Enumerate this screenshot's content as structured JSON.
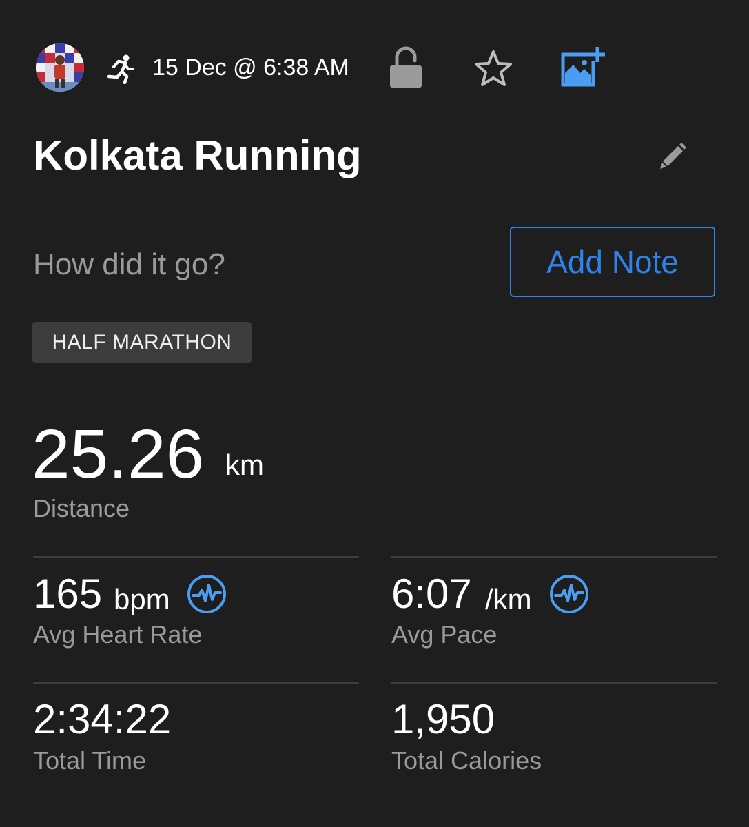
{
  "header": {
    "activity_icon": "running-person-icon",
    "date_time": "15 Dec @ 6:38 AM",
    "privacy_icon": "unlocked-padlock-icon",
    "favorite_icon": "star-outline-icon",
    "add_photo_icon": "add-photo-icon"
  },
  "activity": {
    "title": "Kolkata Running",
    "edit_icon": "pencil-icon",
    "note_prompt": "How did it go?",
    "add_note_label": "Add Note",
    "badge": "HALF MARATHON"
  },
  "distance": {
    "value": "25.26",
    "unit": "km",
    "label": "Distance"
  },
  "stats": {
    "heart_rate": {
      "value": "165",
      "unit": "bpm",
      "label": "Avg Heart Rate",
      "icon": "pulse-chart-icon"
    },
    "pace": {
      "value": "6:07",
      "unit": "/km",
      "label": "Avg Pace",
      "icon": "pulse-chart-icon"
    },
    "time": {
      "value": "2:34:22",
      "label": "Total Time"
    },
    "calories": {
      "value": "1,950",
      "label": "Total Calories"
    }
  },
  "colors": {
    "background": "#1e1e1e",
    "accent": "#2f82e8",
    "icon_blue": "#4a9df0",
    "secondary_text": "#9a9a9a",
    "badge_bg": "#3c3c3c",
    "divider": "#3d3d3d"
  }
}
